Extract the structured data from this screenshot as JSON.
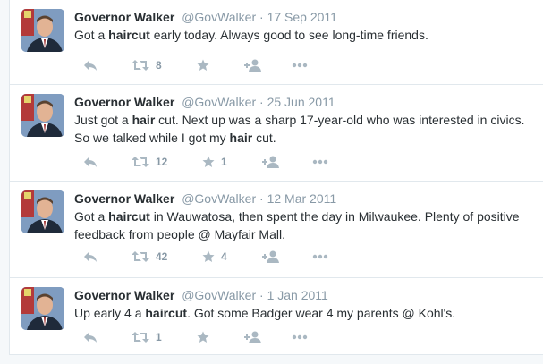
{
  "tweets": [
    {
      "name": "Governor Walker",
      "handle": "@GovWalker",
      "separator": "·",
      "date": "17 Sep 2011",
      "text_parts": [
        "Got a ",
        "haircut",
        " early today. Always good to see long-time friends."
      ],
      "retweets": "8",
      "favorites": ""
    },
    {
      "name": "Governor Walker",
      "handle": "@GovWalker",
      "separator": "·",
      "date": "25 Jun 2011",
      "text_parts": [
        "Just got a ",
        "hair",
        " cut. Next up was a sharp 17-year-old who was interested in civics. So we talked while I got my ",
        "hair",
        " cut."
      ],
      "retweets": "12",
      "favorites": "1"
    },
    {
      "name": "Governor Walker",
      "handle": "@GovWalker",
      "separator": "·",
      "date": "12 Mar 2011",
      "text_parts": [
        "Got a ",
        "haircut",
        " in Wauwatosa, then spent the day in Milwaukee. Plenty of positive feedback from people @ Mayfair Mall."
      ],
      "retweets": "42",
      "favorites": "4"
    },
    {
      "name": "Governor Walker",
      "handle": "@GovWalker",
      "separator": "·",
      "date": "1 Jan 2011",
      "text_parts": [
        "Up early 4 a ",
        "haircut",
        ". Got some Badger wear 4 my parents @ Kohl's."
      ],
      "retweets": "1",
      "favorites": ""
    }
  ],
  "icons": {
    "reply": "reply-icon",
    "retweet": "retweet-icon",
    "favorite": "star-icon",
    "follow": "follow-icon",
    "more": "more-icon"
  },
  "colors": {
    "action_gray": "#aab8c2",
    "meta_gray": "#8899a6",
    "text": "#292f33",
    "border": "#e1e8ed"
  }
}
